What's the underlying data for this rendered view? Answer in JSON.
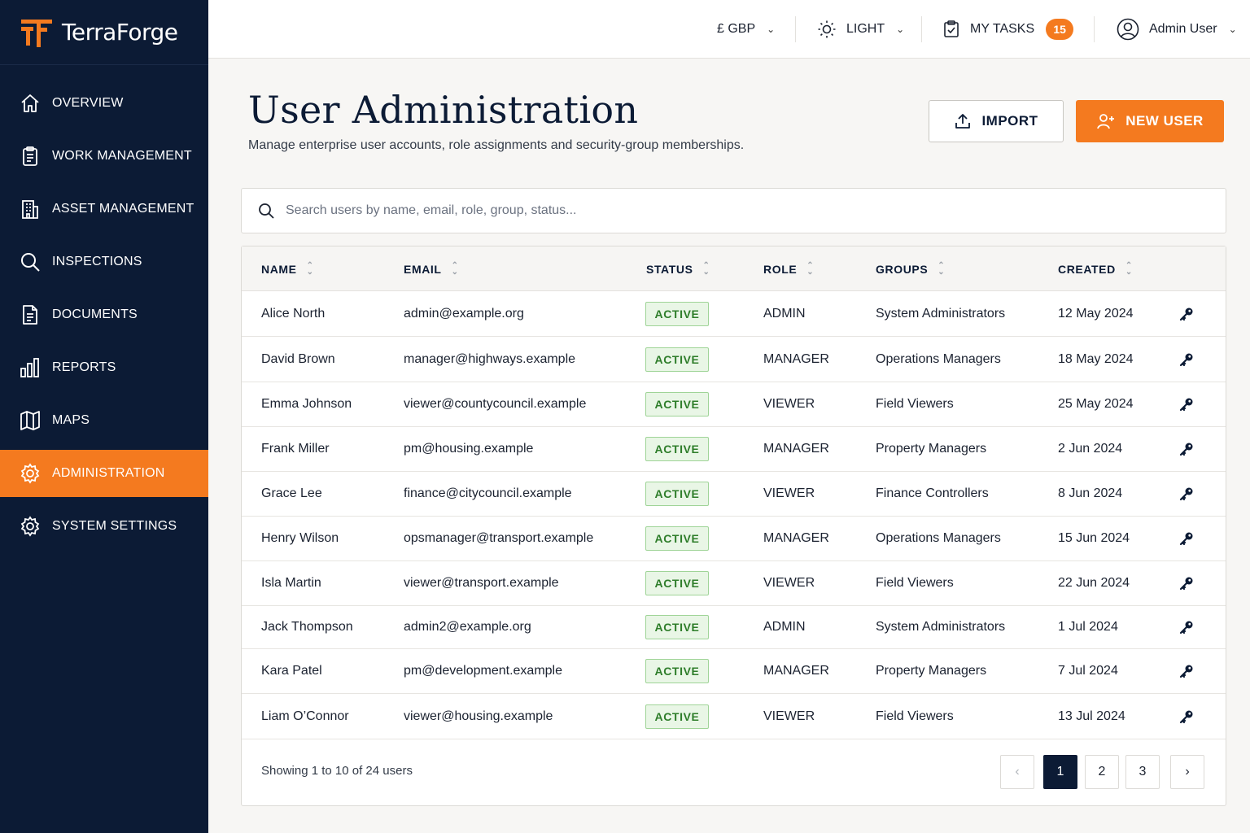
{
  "brand": {
    "name": "TerraForge"
  },
  "colors": {
    "navy": "#0c1b35",
    "accent": "#f47a1f",
    "active_green": "#2e7d2a"
  },
  "sidebar": {
    "items": [
      {
        "label": "OVERVIEW",
        "icon": "home-icon"
      },
      {
        "label": "WORK MANAGEMENT",
        "icon": "clipboard-icon"
      },
      {
        "label": "ASSET MANAGEMENT",
        "icon": "building-icon"
      },
      {
        "label": "INSPECTIONS",
        "icon": "search-icon"
      },
      {
        "label": "DOCUMENTS",
        "icon": "document-icon"
      },
      {
        "label": "REPORTS",
        "icon": "bar-chart-icon"
      },
      {
        "label": "MAPS",
        "icon": "map-icon"
      },
      {
        "label": "ADMINISTRATION",
        "icon": "gear-icon",
        "active": true
      },
      {
        "label": "SYSTEM SETTINGS",
        "icon": "gear-icon"
      }
    ]
  },
  "topbar": {
    "currency": "£ GBP",
    "theme": "LIGHT",
    "tasks_label": "MY TASKS",
    "tasks_count": "15",
    "user": "Admin User"
  },
  "header": {
    "title": "User Administration",
    "subtitle": "Manage enterprise user accounts, role assignments and security-group memberships.",
    "import_label": "IMPORT",
    "new_user_label": "NEW USER"
  },
  "search": {
    "placeholder": "Search users by name, email, role, group, status..."
  },
  "table": {
    "columns": [
      "NAME",
      "EMAIL",
      "STATUS",
      "ROLE",
      "GROUPS",
      "CREATED"
    ],
    "rows": [
      [
        "Alice North",
        "admin@example.org",
        "ACTIVE",
        "ADMIN",
        "System Administrators",
        "12 May 2024"
      ],
      [
        "David Brown",
        "manager@highways.example",
        "ACTIVE",
        "MANAGER",
        "Operations Managers",
        "18 May 2024"
      ],
      [
        "Emma Johnson",
        "viewer@countycouncil.example",
        "ACTIVE",
        "VIEWER",
        "Field Viewers",
        "25 May 2024"
      ],
      [
        "Frank Miller",
        "pm@housing.example",
        "ACTIVE",
        "MANAGER",
        "Property Managers",
        "2 Jun 2024"
      ],
      [
        "Grace Lee",
        "finance@citycouncil.example",
        "ACTIVE",
        "VIEWER",
        "Finance Controllers",
        "8 Jun 2024"
      ],
      [
        "Henry Wilson",
        "opsmanager@transport.example",
        "ACTIVE",
        "MANAGER",
        "Operations Managers",
        "15 Jun 2024"
      ],
      [
        "Isla Martin",
        "viewer@transport.example",
        "ACTIVE",
        "VIEWER",
        "Field Viewers",
        "22 Jun 2024"
      ],
      [
        "Jack Thompson",
        "admin2@example.org",
        "ACTIVE",
        "ADMIN",
        "System Administrators",
        "1 Jul 2024"
      ],
      [
        "Kara Patel",
        "pm@development.example",
        "ACTIVE",
        "MANAGER",
        "Property Managers",
        "7 Jul 2024"
      ],
      [
        "Liam O’Connor",
        "viewer@housing.example",
        "ACTIVE",
        "VIEWER",
        "Field Viewers",
        "13 Jul 2024"
      ]
    ]
  },
  "pagination": {
    "summary": "Showing 1 to 10 of 24 users",
    "pages": [
      "1",
      "2",
      "3"
    ],
    "current": "1"
  }
}
